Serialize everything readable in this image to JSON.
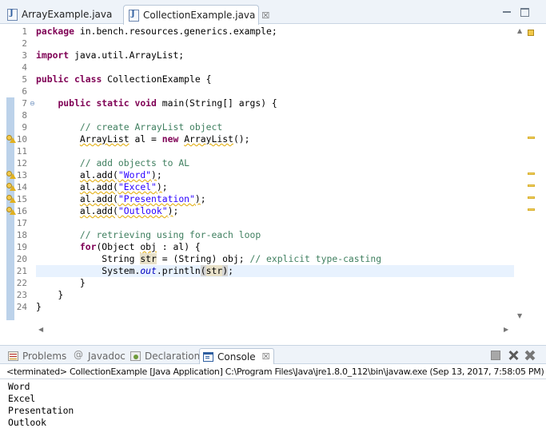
{
  "editor_tabs": [
    {
      "label": "ArrayExample.java",
      "active": false
    },
    {
      "label": "CollectionExample.java",
      "active": true,
      "close_glyph": "☒"
    }
  ],
  "code_lines": [
    {
      "num": "1",
      "tokens": [
        {
          "t": "package",
          "c": "kw"
        },
        {
          "t": " in.bench.resources.generics.example;"
        }
      ]
    },
    {
      "num": "2",
      "tokens": []
    },
    {
      "num": "3",
      "tokens": [
        {
          "t": "import",
          "c": "kw"
        },
        {
          "t": " java.util.ArrayList;"
        }
      ]
    },
    {
      "num": "4",
      "tokens": []
    },
    {
      "num": "5",
      "tokens": [
        {
          "t": "public",
          "c": "kw"
        },
        {
          "t": " "
        },
        {
          "t": "class",
          "c": "kw"
        },
        {
          "t": " CollectionExample {"
        }
      ]
    },
    {
      "num": "6",
      "tokens": []
    },
    {
      "num": "7",
      "fold": true,
      "tokens": [
        {
          "t": "    "
        },
        {
          "t": "public",
          "c": "kw"
        },
        {
          "t": " "
        },
        {
          "t": "static",
          "c": "kw"
        },
        {
          "t": " "
        },
        {
          "t": "void",
          "c": "kw"
        },
        {
          "t": " main(String[] args) {"
        }
      ]
    },
    {
      "num": "8",
      "tokens": []
    },
    {
      "num": "9",
      "tokens": [
        {
          "t": "        "
        },
        {
          "t": "// create ArrayList object",
          "c": "cm"
        }
      ]
    },
    {
      "num": "10",
      "warning": true,
      "tokens": [
        {
          "t": "        "
        },
        {
          "t": "ArrayList",
          "c": "warn"
        },
        {
          "t": " al = "
        },
        {
          "t": "new",
          "c": "kw"
        },
        {
          "t": " "
        },
        {
          "t": "ArrayList",
          "c": "warn"
        },
        {
          "t": "();"
        }
      ]
    },
    {
      "num": "11",
      "tokens": []
    },
    {
      "num": "12",
      "tokens": [
        {
          "t": "        "
        },
        {
          "t": "// add objects to AL",
          "c": "cm"
        }
      ]
    },
    {
      "num": "13",
      "warning": true,
      "tokens": [
        {
          "t": "        "
        },
        {
          "t": "al.add(\"Word\")",
          "c": "warn",
          "inner": [
            {
              "t": "al.add("
            },
            {
              "t": "\"Word\"",
              "c": "st"
            },
            {
              "t": ")"
            }
          ]
        },
        {
          "t": ";"
        }
      ]
    },
    {
      "num": "14",
      "warning": true,
      "tokens": [
        {
          "t": "        "
        },
        {
          "t": "al.add(\"Excel\")",
          "c": "warn",
          "inner": [
            {
              "t": "al.add("
            },
            {
              "t": "\"Excel\"",
              "c": "st"
            },
            {
              "t": ")"
            }
          ]
        },
        {
          "t": ";"
        }
      ]
    },
    {
      "num": "15",
      "warning": true,
      "tokens": [
        {
          "t": "        "
        },
        {
          "t": "al.add(\"Presentation\")",
          "c": "warn",
          "inner": [
            {
              "t": "al.add("
            },
            {
              "t": "\"Presentation\"",
              "c": "st"
            },
            {
              "t": ")"
            }
          ]
        },
        {
          "t": ";"
        }
      ]
    },
    {
      "num": "16",
      "warning": true,
      "tokens": [
        {
          "t": "        "
        },
        {
          "t": "al.add(\"Outlook\")",
          "c": "warn",
          "inner": [
            {
              "t": "al.add("
            },
            {
              "t": "\"Outlook\"",
              "c": "st"
            },
            {
              "t": ")"
            }
          ]
        },
        {
          "t": ";"
        }
      ]
    },
    {
      "num": "17",
      "tokens": []
    },
    {
      "num": "18",
      "tokens": [
        {
          "t": "        "
        },
        {
          "t": "// retrieving using for-each loop",
          "c": "cm"
        }
      ]
    },
    {
      "num": "19",
      "tokens": [
        {
          "t": "        "
        },
        {
          "t": "for",
          "c": "kw"
        },
        {
          "t": "(Object "
        },
        {
          "t": "obj",
          "c": "warn"
        },
        {
          "t": " : al) {"
        }
      ]
    },
    {
      "num": "20",
      "tokens": [
        {
          "t": "            String "
        },
        {
          "t": "str",
          "c": "hl-var"
        },
        {
          "t": " = (String) obj; "
        },
        {
          "t": "// explicit type-casting",
          "c": "cm"
        }
      ]
    },
    {
      "num": "21",
      "current": true,
      "tokens": [
        {
          "t": "            System."
        },
        {
          "t": "out",
          "c": "fld it"
        },
        {
          "t": ".println"
        },
        {
          "t": "(",
          "c": "hl-sel"
        },
        {
          "t": "str",
          "c": "hl-var"
        },
        {
          "t": ")",
          "c": "hl-sel"
        },
        {
          "t": ";"
        }
      ]
    },
    {
      "num": "22",
      "tokens": [
        {
          "t": "        }"
        }
      ]
    },
    {
      "num": "23",
      "tokens": [
        {
          "t": "    }"
        }
      ]
    },
    {
      "num": "24",
      "tokens": [
        {
          "t": "}"
        }
      ]
    }
  ],
  "view_tabs": [
    {
      "label": "Problems",
      "icon": "problems-icon",
      "active": false
    },
    {
      "label": "Javadoc",
      "icon": "javadoc-icon",
      "active": false
    },
    {
      "label": "Declaration",
      "icon": "declaration-icon",
      "active": false
    },
    {
      "label": "Console",
      "icon": "console-icon",
      "active": true,
      "close_glyph": "☒"
    }
  ],
  "console": {
    "header": "<terminated> CollectionExample [Java Application] C:\\Program Files\\Java\\jre1.8.0_112\\bin\\javaw.exe (Sep 13, 2017, 7:58:05 PM)",
    "output": [
      "Word",
      "Excel",
      "Presentation",
      "Outlook"
    ]
  },
  "colors": {
    "keyword": "#7f0055",
    "comment": "#3f7f5f",
    "string": "#2a00ff",
    "field": "#0000c0",
    "current_line": "#e8f2fe"
  }
}
